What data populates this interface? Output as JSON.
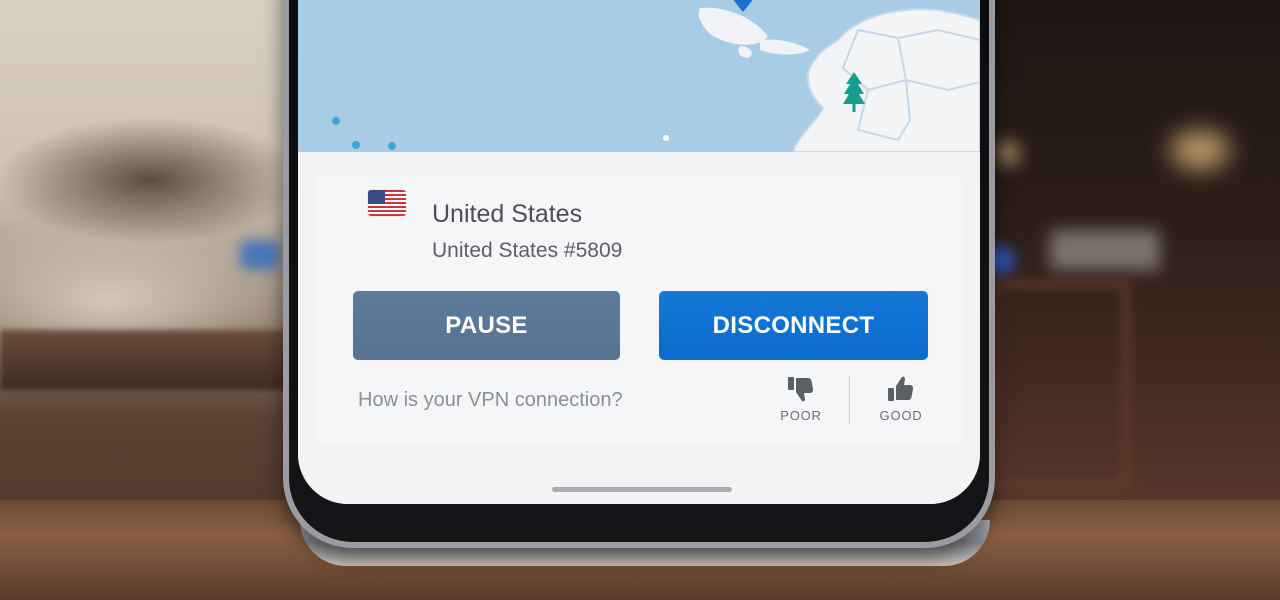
{
  "location": {
    "country": "United States",
    "server": "United States #5809"
  },
  "actions": {
    "pause_label": "PAUSE",
    "disconnect_label": "DISCONNECT"
  },
  "feedback": {
    "question": "How is your VPN connection?",
    "poor_label": "POOR",
    "good_label": "GOOD"
  },
  "icons": {
    "map_pin": "map-pin-icon",
    "tree": "tree-icon",
    "flag": "us-flag-icon",
    "thumbs_down": "thumbs-down-icon",
    "thumbs_up": "thumbs-up-icon"
  },
  "colors": {
    "pause_button": "#5a7897",
    "disconnect_button": "#0f72d3",
    "map_water": "#a9cce6",
    "map_pin": "#1a6fd1",
    "tree": "#159e8e"
  }
}
